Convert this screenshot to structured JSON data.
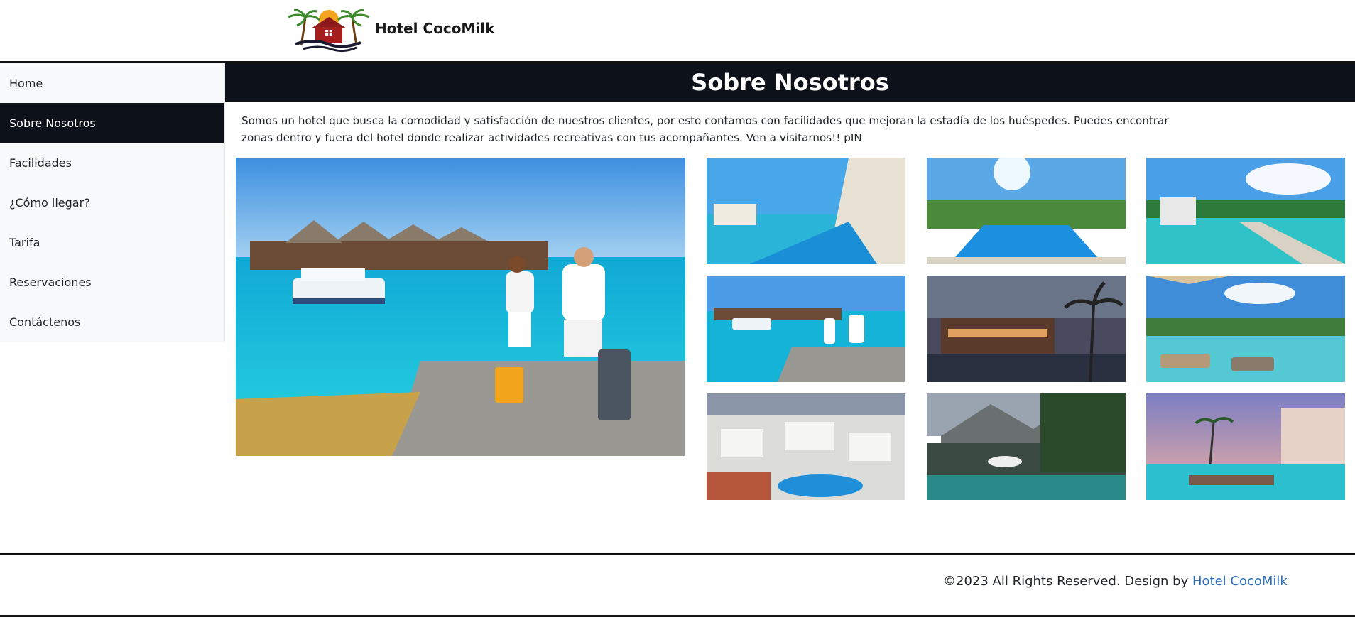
{
  "brand": {
    "name": "Hotel CocoMilk",
    "logo_icon": "hotel-palm-logo"
  },
  "sidebar": {
    "items": [
      {
        "label": "Home",
        "active": false
      },
      {
        "label": "Sobre Nosotros",
        "active": true
      },
      {
        "label": "Facilidades",
        "active": false
      },
      {
        "label": "¿Cómo llegar?",
        "active": false
      },
      {
        "label": "Tarifa",
        "active": false
      },
      {
        "label": "Reservaciones",
        "active": false
      },
      {
        "label": "Contáctenos",
        "active": false
      }
    ]
  },
  "main": {
    "title": "Sobre Nosotros",
    "description": "Somos un hotel que busca la comodidad y satisfacción de nuestros clientes, por esto contamos con facilidades que mejoran la estadía de los huéspedes. Puedes encontrar zonas dentro y fuera del hotel donde realizar actividades recreativas con tus acompañantes. Ven a visitarnos!! pIN"
  },
  "footer": {
    "text": "©2023 All Rights Reserved. Design by ",
    "link_text": "Hotel CocoMilk"
  },
  "colors": {
    "dark": "#0d111a",
    "link": "#2a6ebd",
    "sidebar_bg": "#f8f9fa"
  }
}
